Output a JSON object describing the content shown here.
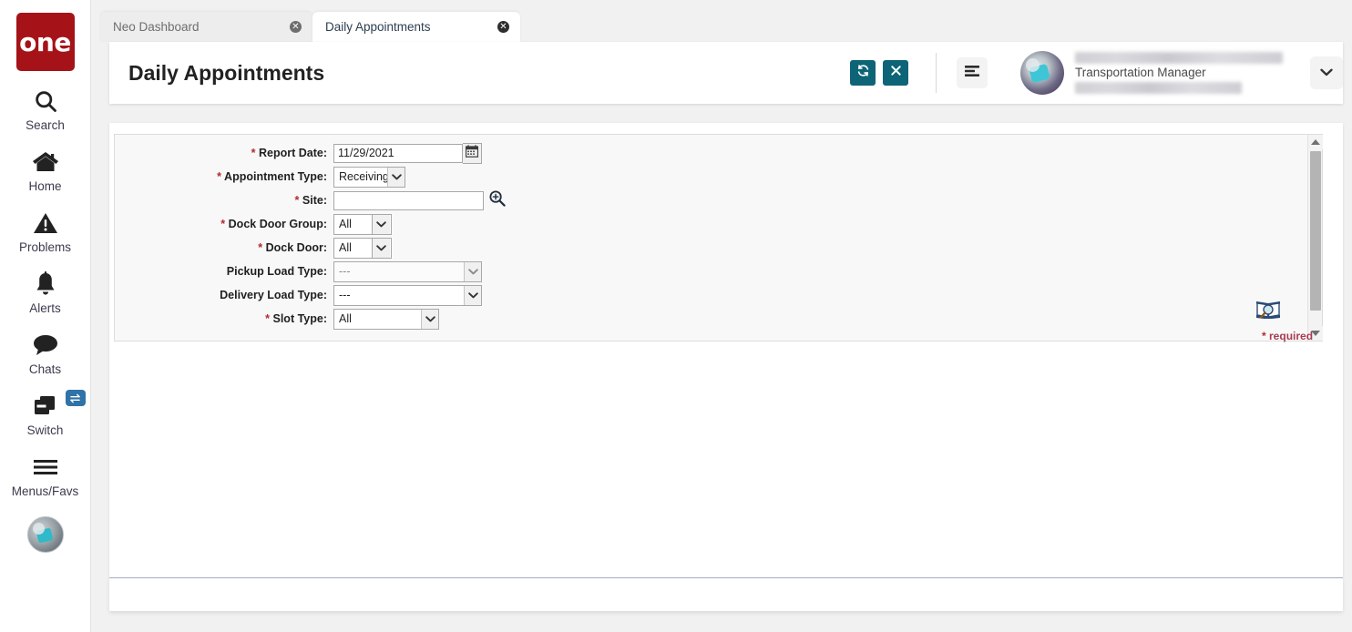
{
  "app": {
    "brand": "one",
    "brand_color": "#a51318",
    "accent_color": "#0d6477"
  },
  "sidebar": {
    "items": [
      {
        "label": "Search",
        "icon": "search-icon"
      },
      {
        "label": "Home",
        "icon": "home-icon"
      },
      {
        "label": "Problems",
        "icon": "warning-triangle-icon"
      },
      {
        "label": "Alerts",
        "icon": "bell-icon"
      },
      {
        "label": "Chats",
        "icon": "chat-bubble-icon"
      },
      {
        "label": "Switch",
        "icon": "windows-stack-icon",
        "badge_icon": "swap-arrows-icon"
      },
      {
        "label": "Menus/Favs",
        "icon": "hamburger-icon"
      }
    ],
    "avatar": "user-avatar"
  },
  "tabs": [
    {
      "label": "Neo Dashboard",
      "active": false,
      "close": "✕"
    },
    {
      "label": "Daily Appointments",
      "active": true,
      "close": "✕"
    }
  ],
  "header": {
    "title": "Daily Appointments",
    "refresh_button": "refresh-icon",
    "close_button": "close-icon",
    "menu_button": "align-menu-icon",
    "caret_button": "chevron-down-icon",
    "user": {
      "name_redacted": "",
      "role": "Transportation Manager",
      "email_redacted": ""
    }
  },
  "form": {
    "fields": [
      {
        "name": "report-date",
        "label": "Report Date:",
        "required": true,
        "control": "text-with-calendar",
        "value": "11/29/2021",
        "placeholder": "",
        "trailing_icon": "calendar-icon"
      },
      {
        "name": "appointment-type",
        "label": "Appointment Type:",
        "required": true,
        "control": "select",
        "value": "Receiving"
      },
      {
        "name": "site",
        "label": "Site:",
        "required": true,
        "control": "text-with-lookup",
        "value": "",
        "placeholder": "",
        "trailing_icon": "magnifier-plus-icon"
      },
      {
        "name": "dock-door-group",
        "label": "Dock Door Group:",
        "required": true,
        "control": "select",
        "value": "All"
      },
      {
        "name": "dock-door",
        "label": "Dock Door:",
        "required": true,
        "control": "select",
        "value": "All"
      },
      {
        "name": "pickup-load-type",
        "label": "Pickup Load Type:",
        "required": false,
        "control": "select",
        "value": "---"
      },
      {
        "name": "delivery-load-type",
        "label": "Delivery Load Type:",
        "required": false,
        "control": "select",
        "value": "---"
      },
      {
        "name": "slot-type",
        "label": "Slot Type:",
        "required": true,
        "control": "select",
        "value": "All"
      }
    ],
    "required_note": "required",
    "required_star": "*",
    "lookup_icon": "book-magnifier-icon",
    "scrollbar": {
      "up_arrow": "triangle-up-icon",
      "down_arrow": "triangle-down-icon"
    }
  }
}
